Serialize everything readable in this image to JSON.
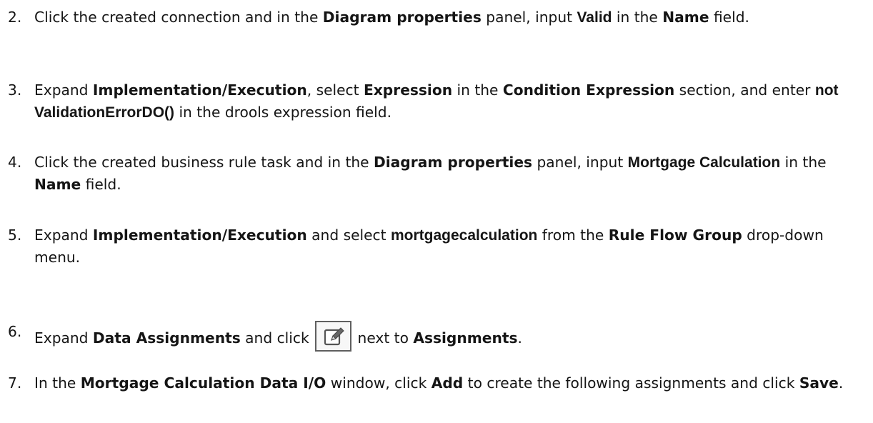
{
  "steps": [
    {
      "number": "2.",
      "parts": [
        "Click the created connection and in the ",
        "Diagram properties",
        " panel, input ",
        "Valid",
        " in the ",
        "Name",
        " field."
      ]
    },
    {
      "number": "3.",
      "parts": [
        "Expand ",
        "Implementation/Execution",
        ", select ",
        "Expression",
        " in the ",
        "Condition Expression",
        " section, and enter ",
        "not ValidationErrorDO()",
        " in the drools expression field."
      ]
    },
    {
      "number": "4.",
      "parts": [
        "Click the created business rule task and in the ",
        "Diagram properties",
        " panel, input ",
        "Mortgage Calculation",
        " in the ",
        "Name",
        " field."
      ]
    },
    {
      "number": "5.",
      "parts": [
        "Expand ",
        "Implementation/Execution",
        " and select ",
        "mortgagecalculation",
        " from the ",
        "Rule Flow Group",
        " drop-down menu."
      ]
    },
    {
      "number": "6.",
      "parts": [
        "Expand ",
        "Data Assignments",
        " and click ",
        " next to ",
        "Assignments",
        "."
      ],
      "icon": "edit-icon"
    },
    {
      "number": "7.",
      "parts": [
        "In the ",
        "Mortgage Calculation Data I/O",
        " window, click ",
        "Add",
        " to create the following assignments and click ",
        "Save",
        "."
      ]
    }
  ]
}
